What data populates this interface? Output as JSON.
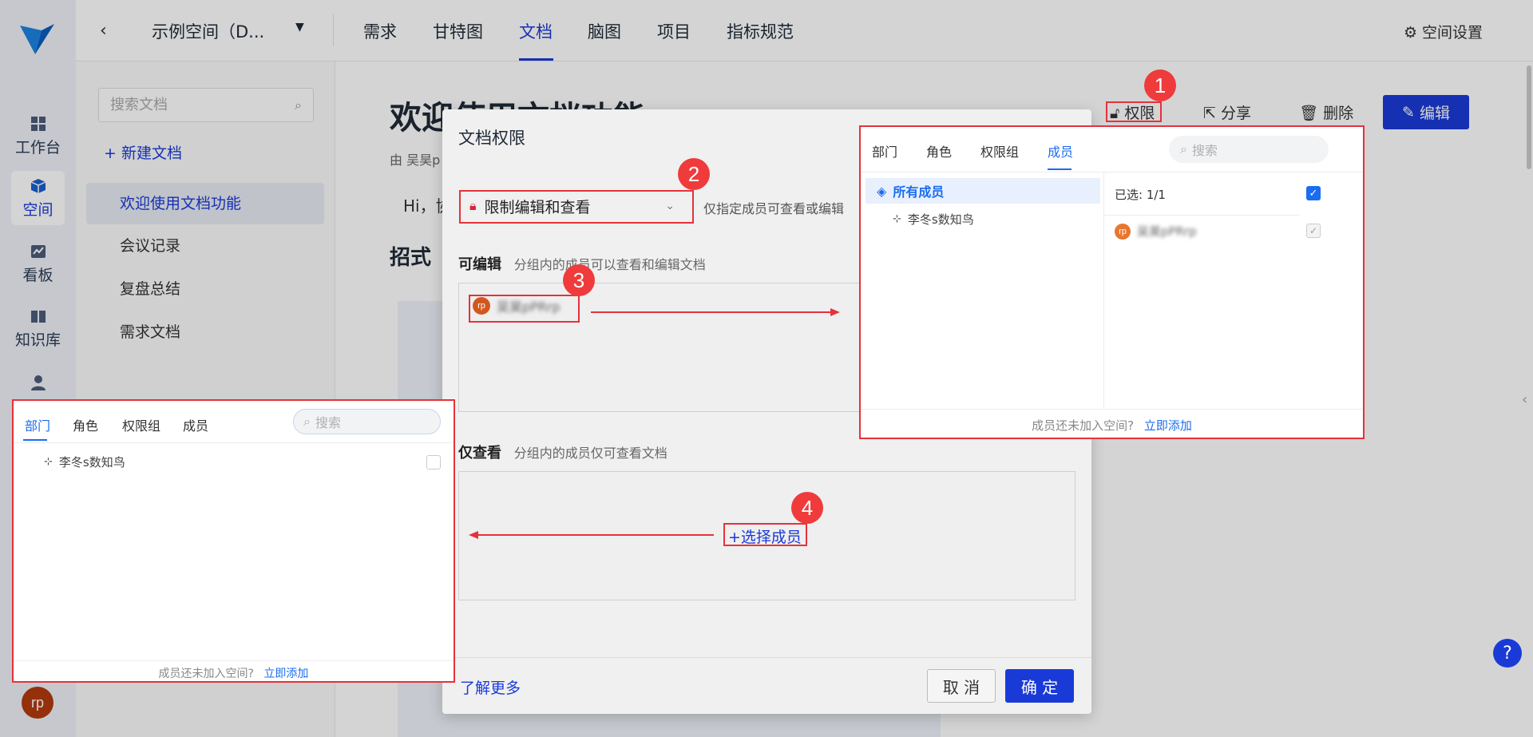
{
  "sidebar": {
    "items": [
      {
        "label": "工作台",
        "icon": "grid-icon"
      },
      {
        "label": "空间",
        "icon": "cube-icon"
      },
      {
        "label": "看板",
        "icon": "chart-icon"
      },
      {
        "label": "知识库",
        "icon": "book-icon"
      },
      {
        "label": "",
        "icon": "user-icon"
      }
    ],
    "avatar_text": "rp"
  },
  "topnav": {
    "space_name": "示例空间（D...",
    "tabs": [
      "需求",
      "甘特图",
      "文档",
      "脑图",
      "项目",
      "指标规范"
    ],
    "active_tab": "文档",
    "settings_label": "空间设置"
  },
  "doclist": {
    "search_placeholder": "搜索文档",
    "new_doc": "新建文档",
    "items": [
      "欢迎使用文档功能",
      "会议记录",
      "复盘总结",
      "需求文档"
    ]
  },
  "main": {
    "title": "欢迎使用文档功能",
    "author": "由 吴昊p",
    "greeting": "Hi，协",
    "heading2": "招式",
    "actions": {
      "permission": "权限",
      "share": "分享",
      "delete": "删除",
      "edit": "编辑"
    }
  },
  "modal": {
    "title": "文档权限",
    "select_value": "限制编辑和查看",
    "select_hint": "仅指定成员可查看或编辑",
    "editable_label": "可编辑",
    "editable_desc": "分组内的成员可以查看和编辑文档",
    "editable_member": "吴昊pPRrp",
    "viewonly_label": "仅查看",
    "viewonly_desc": "分组内的成员仅可查看文档",
    "select_member": "选择成员",
    "learn_more": "了解更多",
    "cancel": "取 消",
    "confirm": "确 定"
  },
  "right_panel": {
    "tabs": [
      "部门",
      "角色",
      "权限组",
      "成员"
    ],
    "active_tab": "成员",
    "search_placeholder": "搜索",
    "all_members": "所有成员",
    "dept_name": "李冬s数知鸟",
    "selected": "已选: 1/1",
    "member_name": "吴昊pPRrp",
    "footer_q": "成员还未加入空间?",
    "footer_link": "立即添加"
  },
  "left_panel": {
    "tabs": [
      "部门",
      "角色",
      "权限组",
      "成员"
    ],
    "active_tab": "部门",
    "search_placeholder": "搜索",
    "dept_name": "李冬s数知鸟",
    "footer_q": "成员还未加入空间?",
    "footer_link": "立即添加"
  },
  "badges": [
    "1",
    "2",
    "3",
    "4"
  ],
  "colors": {
    "accent": "#1a3ad8",
    "link": "#1a6cf0",
    "annotation": "#e5323b"
  }
}
